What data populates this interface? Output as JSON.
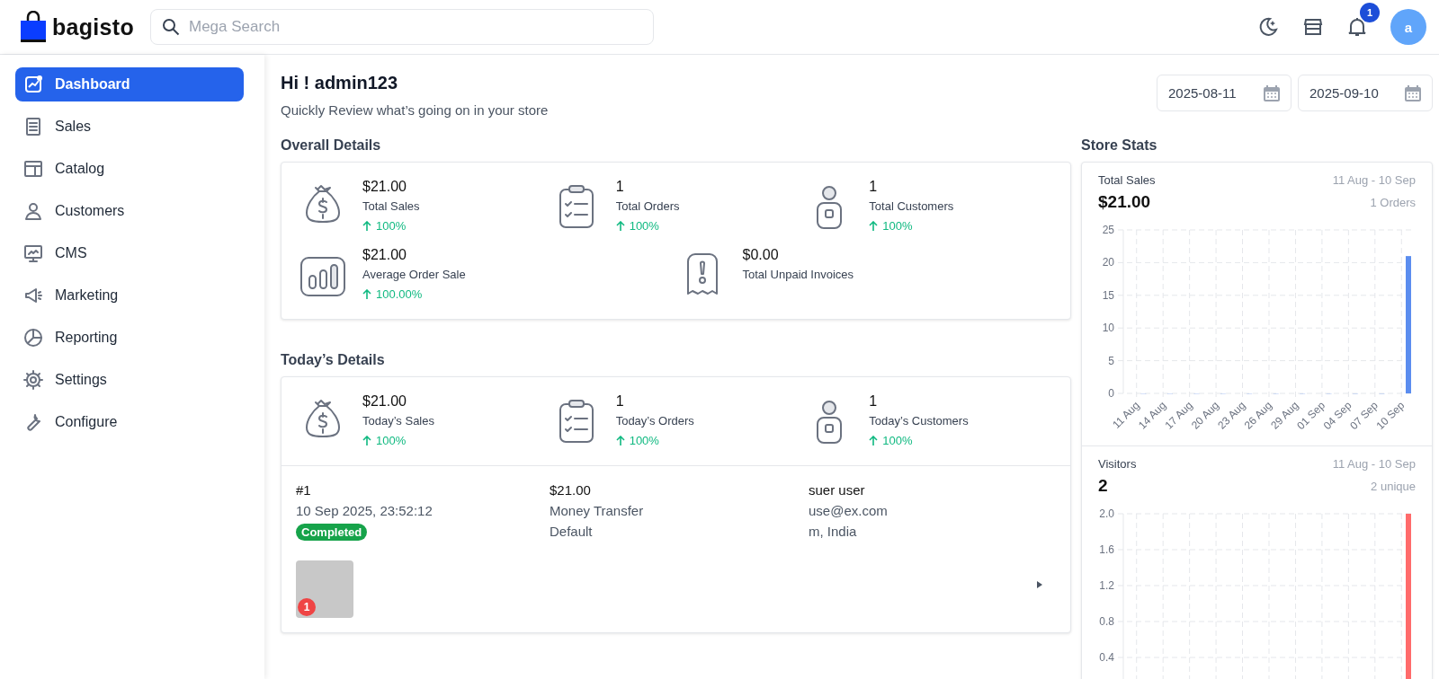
{
  "header": {
    "logo_text": "bagisto",
    "search": {
      "placeholder": "Mega Search"
    },
    "notification_count": "1",
    "avatar_letter": "a"
  },
  "sidebar": {
    "items": [
      {
        "label": "Dashboard",
        "selected": true
      },
      {
        "label": "Sales",
        "selected": false
      },
      {
        "label": "Catalog",
        "selected": false
      },
      {
        "label": "Customers",
        "selected": false
      },
      {
        "label": "CMS",
        "selected": false
      },
      {
        "label": "Marketing",
        "selected": false
      },
      {
        "label": "Reporting",
        "selected": false
      },
      {
        "label": "Settings",
        "selected": false
      },
      {
        "label": "Configure",
        "selected": false
      }
    ]
  },
  "greeting": {
    "title": "Hi ! admin123",
    "subtitle": "Quickly Review what’s going on in your store"
  },
  "date_range": {
    "from": "2025-08-11",
    "to": "2025-09-10"
  },
  "overall": {
    "title": "Overall Details",
    "stats": [
      {
        "value": "$21.00",
        "label": "Total Sales",
        "change": "100%"
      },
      {
        "value": "1",
        "label": "Total Orders",
        "change": "100%"
      },
      {
        "value": "1",
        "label": "Total Customers",
        "change": "100%"
      },
      {
        "value": "$21.00",
        "label": "Average Order Sale",
        "change": "100.00%"
      },
      {
        "value": "$0.00",
        "label": "Total Unpaid Invoices"
      }
    ]
  },
  "today": {
    "title": "Today’s Details",
    "stats": [
      {
        "value": "$21.00",
        "label": "Today’s Sales",
        "change": "100%"
      },
      {
        "value": "1",
        "label": "Today’s Orders",
        "change": "100%"
      },
      {
        "value": "1",
        "label": "Today’s Customers",
        "change": "100%"
      }
    ],
    "orders": [
      {
        "number": "#1",
        "date": "10 Sep 2025, 23:52:12",
        "status": "Completed",
        "total": "$21.00",
        "payment": "Money Transfer",
        "channel": "Default",
        "customer": "suer user",
        "email": "use@ex.com",
        "location": "m, India",
        "item_count": "1"
      }
    ]
  },
  "store_stats": {
    "title": "Store Stats",
    "panels": [
      {
        "title": "Total Sales",
        "value": "$21.00",
        "range": "11 Aug - 10 Sep",
        "note": "1 Orders",
        "chart_data": {
          "type": "bar",
          "categories": [
            "11 Aug",
            "14 Aug",
            "17 Aug",
            "20 Aug",
            "23 Aug",
            "26 Aug",
            "29 Aug",
            "01 Sep",
            "04 Sep",
            "07 Sep",
            "10 Sep"
          ],
          "series": [
            {
              "color": "#5b8def",
              "values": [
                0,
                0,
                0,
                0,
                0,
                0,
                0,
                0,
                0,
                0,
                21
              ]
            }
          ],
          "ylim": [
            0,
            25
          ],
          "yticks": [
            0,
            5,
            10,
            15,
            20,
            25
          ],
          "grid": true
        }
      },
      {
        "title": "Visitors",
        "value": "2",
        "range": "11 Aug - 10 Sep",
        "note": "2 unique",
        "chart_data": {
          "type": "bar",
          "series": [
            {
              "color": "#ff6b6b",
              "values": [
                0,
                0,
                0,
                0,
                0,
                0,
                0,
                0,
                0,
                0,
                2
              ]
            }
          ],
          "ylim": [
            0,
            2
          ],
          "yticks": [
            0.4,
            0.8,
            1.2,
            1.6,
            {
              "value": 2,
              "label": "2.0"
            }
          ],
          "grid": true
        }
      }
    ]
  }
}
